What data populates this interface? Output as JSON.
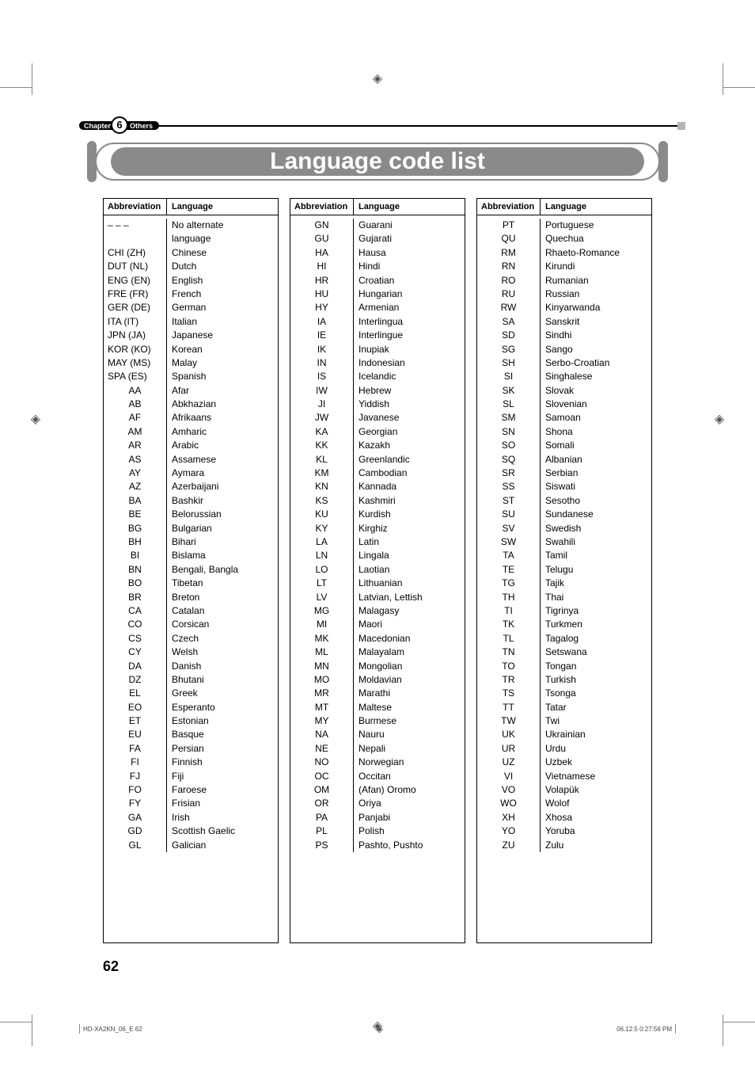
{
  "chapter": {
    "label_left": "Chapter",
    "number": "6",
    "label_right": "Others"
  },
  "title": "Language code list",
  "page_number": "62",
  "footer_left": "HD-XA2KN_06_E   62",
  "footer_right": "06.12.5   0:27:56 PM",
  "columns": {
    "abbr": "Abbreviation",
    "lang": "Language"
  },
  "tables": [
    [
      {
        "abbr": "– – –",
        "lang": "No alternate language",
        "long": true,
        "multiline": true
      },
      {
        "abbr": "CHI (ZH)",
        "lang": "Chinese",
        "long": true
      },
      {
        "abbr": "DUT (NL)",
        "lang": "Dutch",
        "long": true
      },
      {
        "abbr": "ENG (EN)",
        "lang": "English",
        "long": true
      },
      {
        "abbr": "FRE (FR)",
        "lang": "French",
        "long": true
      },
      {
        "abbr": "GER (DE)",
        "lang": "German",
        "long": true
      },
      {
        "abbr": "ITA (IT)",
        "lang": "Italian",
        "long": true
      },
      {
        "abbr": "JPN (JA)",
        "lang": "Japanese",
        "long": true
      },
      {
        "abbr": "KOR (KO)",
        "lang": "Korean",
        "long": true
      },
      {
        "abbr": "MAY (MS)",
        "lang": "Malay",
        "long": true
      },
      {
        "abbr": "SPA (ES)",
        "lang": "Spanish",
        "long": true
      },
      {
        "abbr": "AA",
        "lang": "Afar"
      },
      {
        "abbr": "AB",
        "lang": "Abkhazian"
      },
      {
        "abbr": "AF",
        "lang": "Afrikaans"
      },
      {
        "abbr": "AM",
        "lang": "Amharic"
      },
      {
        "abbr": "AR",
        "lang": "Arabic"
      },
      {
        "abbr": "AS",
        "lang": "Assamese"
      },
      {
        "abbr": "AY",
        "lang": "Aymara"
      },
      {
        "abbr": "AZ",
        "lang": "Azerbaijani"
      },
      {
        "abbr": "BA",
        "lang": "Bashkir"
      },
      {
        "abbr": "BE",
        "lang": "Belorussian"
      },
      {
        "abbr": "BG",
        "lang": "Bulgarian"
      },
      {
        "abbr": "BH",
        "lang": "Bihari"
      },
      {
        "abbr": "BI",
        "lang": "Bislama"
      },
      {
        "abbr": "BN",
        "lang": "Bengali, Bangla"
      },
      {
        "abbr": "BO",
        "lang": "Tibetan"
      },
      {
        "abbr": "BR",
        "lang": "Breton"
      },
      {
        "abbr": "CA",
        "lang": "Catalan"
      },
      {
        "abbr": "CO",
        "lang": "Corsican"
      },
      {
        "abbr": "CS",
        "lang": "Czech"
      },
      {
        "abbr": "CY",
        "lang": "Welsh"
      },
      {
        "abbr": "DA",
        "lang": "Danish"
      },
      {
        "abbr": "DZ",
        "lang": "Bhutani"
      },
      {
        "abbr": "EL",
        "lang": "Greek"
      },
      {
        "abbr": "EO",
        "lang": "Esperanto"
      },
      {
        "abbr": "ET",
        "lang": "Estonian"
      },
      {
        "abbr": "EU",
        "lang": "Basque"
      },
      {
        "abbr": "FA",
        "lang": "Persian"
      },
      {
        "abbr": "FI",
        "lang": "Finnish"
      },
      {
        "abbr": "FJ",
        "lang": "Fiji"
      },
      {
        "abbr": "FO",
        "lang": "Faroese"
      },
      {
        "abbr": "FY",
        "lang": "Frisian"
      },
      {
        "abbr": "GA",
        "lang": "Irish"
      },
      {
        "abbr": "GD",
        "lang": "Scottish Gaelic"
      },
      {
        "abbr": "GL",
        "lang": "Galician"
      }
    ],
    [
      {
        "abbr": "GN",
        "lang": "Guarani"
      },
      {
        "abbr": "GU",
        "lang": "Gujarati"
      },
      {
        "abbr": "HA",
        "lang": "Hausa"
      },
      {
        "abbr": "HI",
        "lang": "Hindi"
      },
      {
        "abbr": "HR",
        "lang": "Croatian"
      },
      {
        "abbr": "HU",
        "lang": "Hungarian"
      },
      {
        "abbr": "HY",
        "lang": "Armenian"
      },
      {
        "abbr": "IA",
        "lang": "Interlingua"
      },
      {
        "abbr": "IE",
        "lang": "Interlingue"
      },
      {
        "abbr": "IK",
        "lang": "Inupiak"
      },
      {
        "abbr": "IN",
        "lang": "Indonesian"
      },
      {
        "abbr": "IS",
        "lang": "Icelandic"
      },
      {
        "abbr": "IW",
        "lang": "Hebrew"
      },
      {
        "abbr": "JI",
        "lang": "Yiddish"
      },
      {
        "abbr": "JW",
        "lang": "Javanese"
      },
      {
        "abbr": "KA",
        "lang": "Georgian"
      },
      {
        "abbr": "KK",
        "lang": "Kazakh"
      },
      {
        "abbr": "KL",
        "lang": "Greenlandic"
      },
      {
        "abbr": "KM",
        "lang": "Cambodian"
      },
      {
        "abbr": "KN",
        "lang": "Kannada"
      },
      {
        "abbr": "KS",
        "lang": "Kashmiri"
      },
      {
        "abbr": "KU",
        "lang": "Kurdish"
      },
      {
        "abbr": "KY",
        "lang": "Kirghiz"
      },
      {
        "abbr": "LA",
        "lang": "Latin"
      },
      {
        "abbr": "LN",
        "lang": "Lingala"
      },
      {
        "abbr": "LO",
        "lang": "Laotian"
      },
      {
        "abbr": "LT",
        "lang": "Lithuanian"
      },
      {
        "abbr": "LV",
        "lang": "Latvian, Lettish"
      },
      {
        "abbr": "MG",
        "lang": "Malagasy"
      },
      {
        "abbr": "MI",
        "lang": "Maori"
      },
      {
        "abbr": "MK",
        "lang": "Macedonian"
      },
      {
        "abbr": "ML",
        "lang": "Malayalam"
      },
      {
        "abbr": "MN",
        "lang": "Mongolian"
      },
      {
        "abbr": "MO",
        "lang": "Moldavian"
      },
      {
        "abbr": "MR",
        "lang": "Marathi"
      },
      {
        "abbr": "MT",
        "lang": "Maltese"
      },
      {
        "abbr": "MY",
        "lang": "Burmese"
      },
      {
        "abbr": "NA",
        "lang": "Nauru"
      },
      {
        "abbr": "NE",
        "lang": "Nepali"
      },
      {
        "abbr": "NO",
        "lang": "Norwegian"
      },
      {
        "abbr": "OC",
        "lang": "Occitan"
      },
      {
        "abbr": "OM",
        "lang": "(Afan) Oromo"
      },
      {
        "abbr": "OR",
        "lang": "Oriya"
      },
      {
        "abbr": "PA",
        "lang": "Panjabi"
      },
      {
        "abbr": "PL",
        "lang": "Polish"
      },
      {
        "abbr": "PS",
        "lang": "Pashto, Pushto"
      }
    ],
    [
      {
        "abbr": "PT",
        "lang": "Portuguese"
      },
      {
        "abbr": "QU",
        "lang": "Quechua"
      },
      {
        "abbr": "RM",
        "lang": "Rhaeto-Romance"
      },
      {
        "abbr": "RN",
        "lang": "Kirundi"
      },
      {
        "abbr": "RO",
        "lang": "Rumanian"
      },
      {
        "abbr": "RU",
        "lang": "Russian"
      },
      {
        "abbr": "RW",
        "lang": "Kinyarwanda"
      },
      {
        "abbr": "SA",
        "lang": "Sanskrit"
      },
      {
        "abbr": "SD",
        "lang": "Sindhi"
      },
      {
        "abbr": "SG",
        "lang": "Sango"
      },
      {
        "abbr": "SH",
        "lang": "Serbo-Croatian"
      },
      {
        "abbr": "SI",
        "lang": "Singhalese"
      },
      {
        "abbr": "SK",
        "lang": "Slovak"
      },
      {
        "abbr": "SL",
        "lang": "Slovenian"
      },
      {
        "abbr": "SM",
        "lang": "Samoan"
      },
      {
        "abbr": "SN",
        "lang": "Shona"
      },
      {
        "abbr": "SO",
        "lang": "Somali"
      },
      {
        "abbr": "SQ",
        "lang": "Albanian"
      },
      {
        "abbr": "SR",
        "lang": "Serbian"
      },
      {
        "abbr": "SS",
        "lang": "Siswati"
      },
      {
        "abbr": "ST",
        "lang": "Sesotho"
      },
      {
        "abbr": "SU",
        "lang": "Sundanese"
      },
      {
        "abbr": "SV",
        "lang": "Swedish"
      },
      {
        "abbr": "SW",
        "lang": "Swahili"
      },
      {
        "abbr": "TA",
        "lang": "Tamil"
      },
      {
        "abbr": "TE",
        "lang": "Telugu"
      },
      {
        "abbr": "TG",
        "lang": "Tajik"
      },
      {
        "abbr": "TH",
        "lang": "Thai"
      },
      {
        "abbr": "TI",
        "lang": "Tigrinya"
      },
      {
        "abbr": "TK",
        "lang": "Turkmen"
      },
      {
        "abbr": "TL",
        "lang": "Tagalog"
      },
      {
        "abbr": "TN",
        "lang": "Setswana"
      },
      {
        "abbr": "TO",
        "lang": "Tongan"
      },
      {
        "abbr": "TR",
        "lang": "Turkish"
      },
      {
        "abbr": "TS",
        "lang": "Tsonga"
      },
      {
        "abbr": "TT",
        "lang": "Tatar"
      },
      {
        "abbr": "TW",
        "lang": "Twi"
      },
      {
        "abbr": "UK",
        "lang": "Ukrainian"
      },
      {
        "abbr": "UR",
        "lang": "Urdu"
      },
      {
        "abbr": "UZ",
        "lang": "Uzbek"
      },
      {
        "abbr": "VI",
        "lang": "Vietnamese"
      },
      {
        "abbr": "VO",
        "lang": "Volapük"
      },
      {
        "abbr": "WO",
        "lang": "Wolof"
      },
      {
        "abbr": "XH",
        "lang": "Xhosa"
      },
      {
        "abbr": "YO",
        "lang": "Yoruba"
      },
      {
        "abbr": "ZU",
        "lang": "Zulu"
      }
    ]
  ]
}
